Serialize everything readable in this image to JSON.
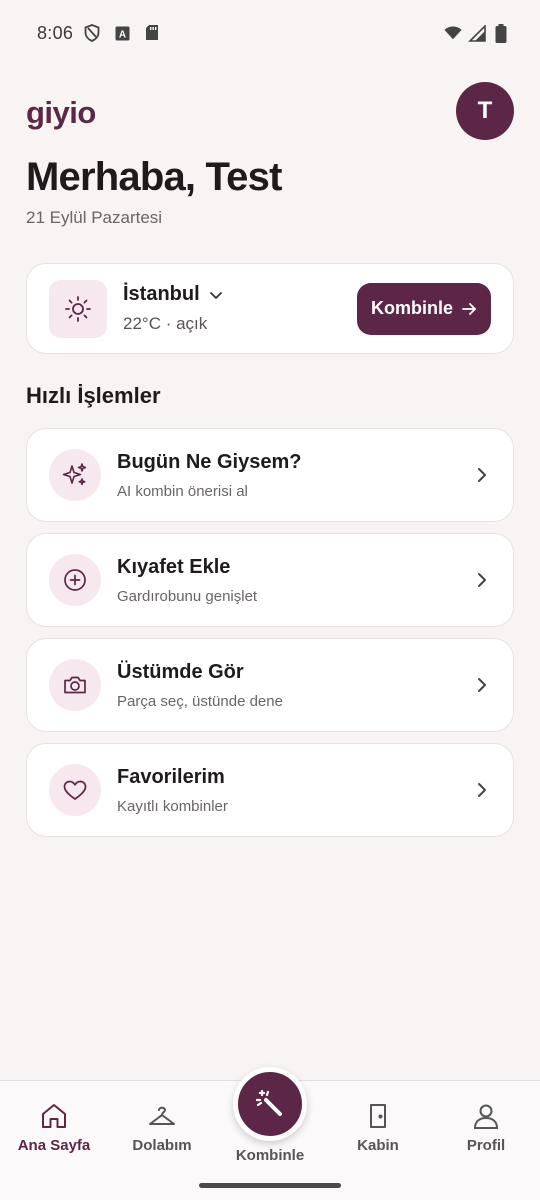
{
  "status_bar": {
    "time": "8:06",
    "icons": [
      "shield-icon",
      "a-box-icon",
      "sd-card-icon",
      "wifi-icon",
      "signal-icon",
      "battery-icon"
    ]
  },
  "header": {
    "logo": "giyio",
    "avatar_initial": "T",
    "greeting": "Merhaba, Test",
    "date": "21 Eylül Pazartesi"
  },
  "weather": {
    "icon": "sun-icon",
    "city": "İstanbul",
    "conditions": "22°C · açık",
    "button_label": "Kombinle"
  },
  "quick_actions": {
    "title": "Hızlı İşlemler",
    "items": [
      {
        "icon": "sparkles-icon",
        "title": "Bugün Ne Giysem?",
        "subtitle": "AI kombin önerisi al"
      },
      {
        "icon": "plus-circle-icon",
        "title": "Kıyafet Ekle",
        "subtitle": "Gardırobunu genişlet"
      },
      {
        "icon": "camera-icon",
        "title": "Üstümde Gör",
        "subtitle": "Parça seç, üstünde dene"
      },
      {
        "icon": "heart-icon",
        "title": "Favorilerim",
        "subtitle": "Kayıtlı kombinler"
      }
    ]
  },
  "bottom_nav": {
    "items": [
      {
        "label": "Ana Sayfa",
        "icon": "home-icon",
        "active": true
      },
      {
        "label": "Dolabım",
        "icon": "hanger-icon",
        "active": false
      },
      {
        "label": "Kombinle",
        "icon": "magic-wand-icon",
        "active": false
      },
      {
        "label": "Kabin",
        "icon": "door-icon",
        "active": false
      },
      {
        "label": "Profil",
        "icon": "person-icon",
        "active": false
      }
    ]
  },
  "colors": {
    "brand": "#5c2746",
    "background": "#f7f4f3",
    "icon_bg": "#f6e8ee"
  }
}
